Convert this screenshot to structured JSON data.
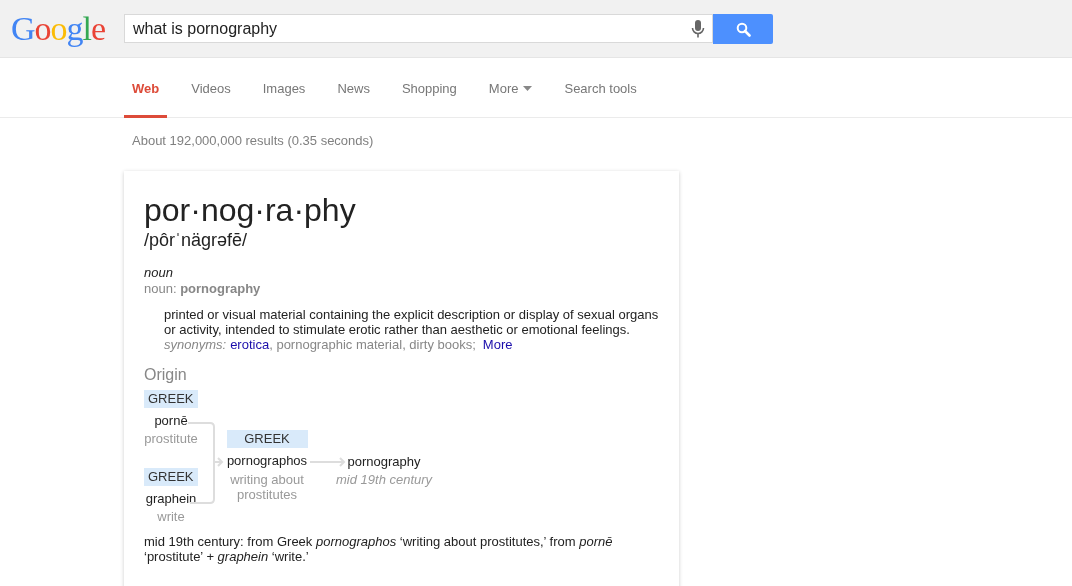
{
  "logo": [
    {
      "letter": "G",
      "color": "#4285f4"
    },
    {
      "letter": "o",
      "color": "#ea4335"
    },
    {
      "letter": "o",
      "color": "#fbbc05"
    },
    {
      "letter": "g",
      "color": "#4285f4"
    },
    {
      "letter": "l",
      "color": "#34a853"
    },
    {
      "letter": "e",
      "color": "#ea4335"
    }
  ],
  "search": {
    "value": "what is pornography"
  },
  "tabs": [
    {
      "label": "Web",
      "selected": true,
      "kind": "plain"
    },
    {
      "label": "Videos",
      "selected": false,
      "kind": "plain"
    },
    {
      "label": "Images",
      "selected": false,
      "kind": "plain"
    },
    {
      "label": "News",
      "selected": false,
      "kind": "plain"
    },
    {
      "label": "Shopping",
      "selected": false,
      "kind": "plain"
    },
    {
      "label": "More",
      "selected": false,
      "kind": "dropdown"
    },
    {
      "label": "Search tools",
      "selected": false,
      "kind": "plain"
    }
  ],
  "result_stats": "About 192,000,000 results (0.35 seconds)",
  "definition": {
    "headword": "por·nog·ra·phy",
    "pronunciation": "/pôrˈnägrəfē/",
    "part_of_speech": "noun",
    "form_label": "noun:",
    "form_word": "pornography",
    "sense": "printed or visual material containing the explicit description or display of sexual organs or activity, intended to stimulate erotic rather than aesthetic or emotional feelings.",
    "synonyms_label": "synonyms:",
    "synonyms": [
      {
        "text": "erotica",
        "link": true
      },
      {
        "text": ", pornographic material, dirty books;",
        "link": false
      }
    ],
    "more": "More"
  },
  "origin": {
    "title": "Origin",
    "roots": [
      {
        "language": "GREEK",
        "word": "pornē",
        "gloss": "prostitute"
      },
      {
        "language": "GREEK",
        "word": "graphein",
        "gloss": "write"
      }
    ],
    "intermediate": {
      "language": "GREEK",
      "word": "pornographos",
      "gloss": "writing about prostitutes"
    },
    "result": {
      "word": "pornography",
      "date": "mid 19th century"
    },
    "note": "mid 19th century: from Greek *pornographos* ‘writing about prostitutes,’ from *pornē* ‘prostitute’ + *graphein* ‘write.’"
  }
}
